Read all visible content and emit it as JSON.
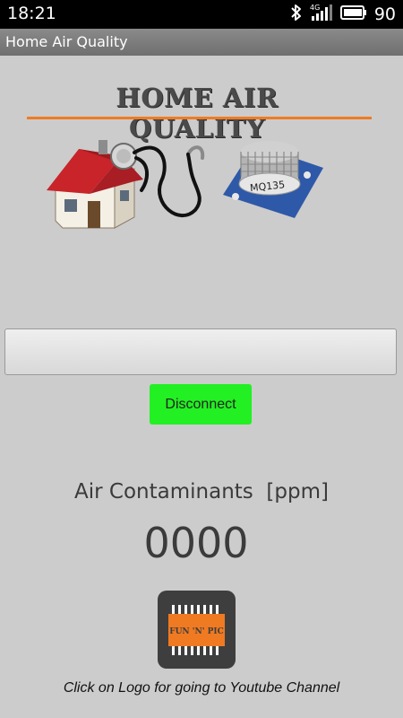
{
  "status_bar": {
    "time": "18:21",
    "network": "4G",
    "battery_percent": "90",
    "icons": [
      "bluetooth-icon",
      "signal-icon",
      "battery-icon"
    ]
  },
  "app": {
    "title": "Home Air Quality"
  },
  "banner": {
    "title": "HOME AIR QUALITY",
    "sensor_label": "MQ135",
    "accent_color": "#f07a22"
  },
  "controls": {
    "wide_button_label": "",
    "disconnect_label": "Disconnect",
    "disconnect_color": "#22f022"
  },
  "reading": {
    "label": "Air Contaminants  [ppm]",
    "value": "0000"
  },
  "logo": {
    "text": "FUN 'N' PIC",
    "caption": "Click on Logo for going to Youtube Channel"
  }
}
